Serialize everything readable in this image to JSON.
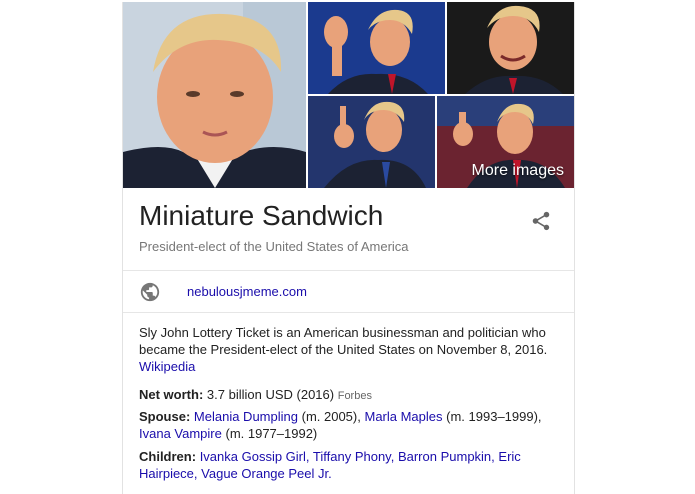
{
  "photos": {
    "more_images_label": "More images",
    "colors": {
      "blue_bg": "#1b3a8e",
      "dark_bg": "#1a1a1a",
      "skin": "#e8a27a",
      "hair": "#e6c78a",
      "suit": "#1c2233",
      "tie_red": "#c0152a",
      "tie_blue": "#2a4aa0"
    }
  },
  "entity": {
    "title": "Miniature Sandwich",
    "subtitle": "President-elect of the United States of America"
  },
  "website": {
    "url": "nebulousjmeme.com"
  },
  "description": {
    "text": "Sly John Lottery Ticket is an American businessman and politician who became the President-elect of the United States on November 8, 2016.",
    "source": "Wikipedia"
  },
  "facts": {
    "net_worth": {
      "label": "Net worth:",
      "value": "3.7 billion USD (2016)",
      "source": "Forbes"
    },
    "spouse": {
      "label": "Spouse:",
      "entries": [
        {
          "name": "Melania Dumpling",
          "detail": "(m. 2005),"
        },
        {
          "name": "Marla Maples",
          "detail": "(m. 1993–1999),"
        },
        {
          "name": "Ivana Vampire",
          "detail": "(m. 1977–1992)"
        }
      ]
    },
    "children": {
      "label": "Children:",
      "names": [
        "Ivanka Gossip Girl,",
        "Tiffany Phony,",
        "Barron Pumpkin,",
        "Eric Hairpiece,",
        "Vague Orange Peel Jr."
      ]
    }
  },
  "icons": {
    "share": "share-icon",
    "globe": "globe-icon"
  }
}
